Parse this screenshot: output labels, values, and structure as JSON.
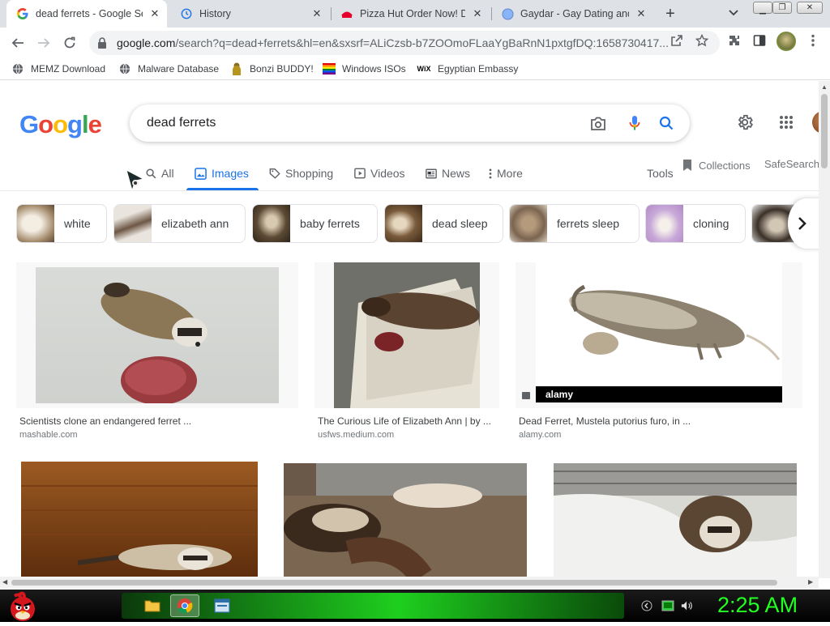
{
  "browser": {
    "tabs": [
      {
        "title": "dead ferrets - Google Search",
        "favicon": "google-g-icon",
        "active": true
      },
      {
        "title": "History",
        "favicon": "history-icon",
        "active": false
      },
      {
        "title": "Pizza Hut Order Now! Delivery",
        "favicon": "pizza-hut-icon",
        "active": false
      },
      {
        "title": "Gaydar - Gay Dating and Chat",
        "favicon": "globe-icon",
        "active": false
      }
    ],
    "url_host": "google.com",
    "url_path": "/search?q=dead+ferrets&hl=en&sxsrf=ALiCzsb-b7ZOOmoFLaaYgBaRnN1pxtgfDQ:1658730417..."
  },
  "bookmarks": [
    {
      "label": "MEMZ Download",
      "icon": "globe-icon"
    },
    {
      "label": "Malware Database",
      "icon": "globe-icon"
    },
    {
      "label": "Bonzi BUDDY!",
      "icon": "bonzi-icon"
    },
    {
      "label": "Windows ISOs",
      "icon": "windows-flag-icon"
    },
    {
      "label": "Egyptian Embassy",
      "icon": "wix-icon"
    }
  ],
  "google": {
    "logo": "Google",
    "query": "dead ferrets",
    "tabs": [
      {
        "label": "All",
        "icon": "search-icon"
      },
      {
        "label": "Images",
        "icon": "image-icon",
        "active": true
      },
      {
        "label": "Shopping",
        "icon": "tag-icon"
      },
      {
        "label": "Videos",
        "icon": "play-icon"
      },
      {
        "label": "News",
        "icon": "news-icon"
      },
      {
        "label": "More",
        "icon": "more-vert-icon"
      }
    ],
    "tools": "Tools",
    "collections": "Collections",
    "safesearch": "SafeSearch",
    "chips": [
      {
        "label": "white"
      },
      {
        "label": "elizabeth ann"
      },
      {
        "label": "baby ferrets"
      },
      {
        "label": "dead sleep"
      },
      {
        "label": "ferrets sleep"
      },
      {
        "label": "cloning"
      }
    ],
    "results": [
      {
        "title": "Scientists clone an endangered ferret ...",
        "source": "mashable.com"
      },
      {
        "title": "The Curious Life of Elizabeth Ann | by ...",
        "source": "usfws.medium.com"
      },
      {
        "title": "Dead Ferret, Mustela putorius furo, in ...",
        "source": "alamy.com",
        "watermark": "alamy"
      },
      {
        "title": "",
        "source": ""
      },
      {
        "title": "",
        "source": ""
      },
      {
        "title": "",
        "source": ""
      }
    ]
  },
  "taskbar": {
    "clock": "2:25 AM"
  },
  "colors": {
    "google_blue": "#4285F4",
    "google_red": "#EA4335",
    "google_yellow": "#FBBC05",
    "google_green": "#34A853",
    "accent": "#1a73e8",
    "clock_green": "#22ff22"
  }
}
